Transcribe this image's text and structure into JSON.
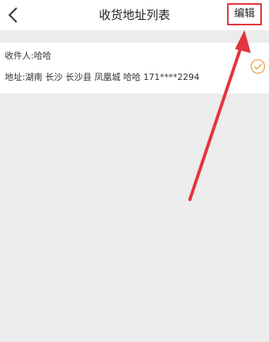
{
  "header": {
    "back_icon": "chevron-left-icon",
    "title": "收货地址列表",
    "edit_label": "编辑"
  },
  "addresses": [
    {
      "receiver": "收件人:哈哈",
      "address": "地址:湖南 长沙 长沙县 凤凰城 哈哈 171****2294",
      "selected_icon": "check-circle-icon"
    }
  ],
  "colors": {
    "page_background": "#ececec",
    "accent_orange": "#f0a552",
    "annotation_red": "#e2353c"
  }
}
